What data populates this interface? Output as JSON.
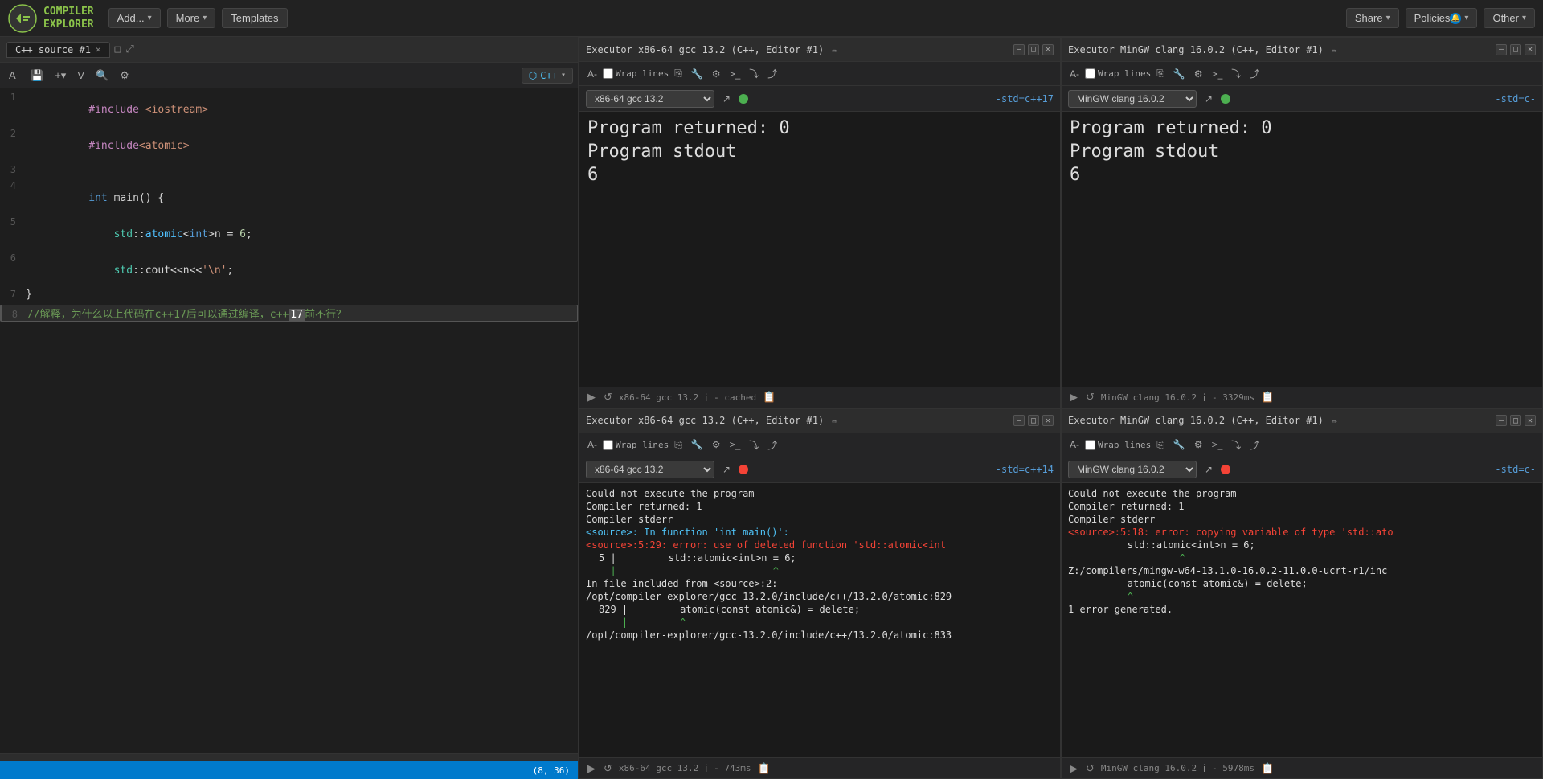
{
  "nav": {
    "logo_line1": "COMPILER",
    "logo_line2": "EXPLORER",
    "add_label": "Add...",
    "more_label": "More",
    "templates_label": "Templates",
    "share_label": "Share",
    "policies_label": "Policies",
    "other_label": "Other"
  },
  "editor": {
    "tab_title": "C++ source #1",
    "lang_label": "C++",
    "lines": [
      {
        "num": "1",
        "content": "#include <iostream>",
        "type": "include"
      },
      {
        "num": "2",
        "content": "#include<atomic>",
        "type": "include"
      },
      {
        "num": "3",
        "content": "",
        "type": "blank"
      },
      {
        "num": "4",
        "content": "int main() {",
        "type": "code"
      },
      {
        "num": "5",
        "content": "    std::atomic<int>n = 6;",
        "type": "code"
      },
      {
        "num": "6",
        "content": "    std::cout<<n<<'\\n';",
        "type": "code"
      },
      {
        "num": "7",
        "content": "}",
        "type": "code"
      },
      {
        "num": "8",
        "content": "//解释，为什么以上代码在c++17后可以通过编译，c++17前不行？",
        "type": "comment"
      }
    ],
    "status_pos": "(8, 36)"
  },
  "panels": [
    {
      "id": "panel-top-left",
      "title": "Executor x86-64 gcc 13.2 (C++, Editor #1)",
      "compiler": "x86-64 gcc 13.2",
      "std_flag": "-std=c++17",
      "status": "success",
      "output_lines": [
        "Program returned: 0",
        "Program stdout",
        "6"
      ],
      "footer_compiler": "x86-64 gcc 13.2",
      "footer_info": "- cached",
      "wrap_lines": "Wrap lines"
    },
    {
      "id": "panel-top-right",
      "title": "Executor MinGW clang 16.0.2 (C++, Editor #1)",
      "compiler": "MinGW clang 16.0.2",
      "std_flag": "-std=c-",
      "status": "success",
      "output_lines": [
        "Program returned: 0",
        "Program stdout",
        "6"
      ],
      "footer_compiler": "MinGW clang 16.0.2",
      "footer_info": "- 3329ms",
      "wrap_lines": "Wrap lines"
    },
    {
      "id": "panel-bottom-left",
      "title": "Executor x86-64 gcc 13.2 (C++, Editor #1)",
      "compiler": "x86-64 gcc 13.2",
      "std_flag": "-std=c++14",
      "status": "error",
      "output_lines": [
        "Could not execute the program",
        "Compiler returned: 1",
        "Compiler stderr",
        "<source>: In function 'int main()':",
        "<source>:5:29: error: use of deleted function 'std::atomic<int",
        "  5 |         std::atomic<int>n = 6;",
        "    |                           ^",
        "In file included from <source>:2:",
        "/opt/compiler-explorer/gcc-13.2.0/include/c++/13.2.0/atomic:829",
        "  829 |         atomic(const atomic&) = delete;",
        "      |         ^",
        "/opt/compiler-explorer/gcc-13.2.0/include/c++/13.2.0/atomic:833"
      ],
      "footer_compiler": "x86-64 gcc 13.2",
      "footer_info": "- 743ms",
      "wrap_lines": "Wrap lines"
    },
    {
      "id": "panel-bottom-right",
      "title": "Executor MinGW clang 16.0.2 (C++, Editor #1)",
      "compiler": "MinGW clang 16.0.2",
      "std_flag": "-std=c-",
      "status": "error",
      "output_lines": [
        "Could not execute the program",
        "Compiler returned: 1",
        "Compiler stderr",
        "<source>:5:18: error: copying variable of type 'std::ato",
        "        std::atomic<int>n = 6;",
        "                 ^",
        "Z:/compilers/mingw-w64-13.1.0-16.0.2-11.0.0-ucrt-r1/inc",
        "        atomic(const atomic&) = delete;",
        "        ^",
        "1 error generated."
      ],
      "footer_compiler": "MinGW clang 16.0.2",
      "footer_info": "- 5978ms",
      "wrap_lines": "Wrap lines"
    }
  ],
  "icons": {
    "logo": "⚙",
    "add_caret": "▾",
    "more_caret": "▾",
    "font_size": "A",
    "save": "💾",
    "add_pane": "+▾",
    "vim": "V",
    "search": "🔍",
    "settings": "⚙",
    "close": "✕",
    "maximize": "□",
    "minimize": "—",
    "run": "▶",
    "refresh": "↺",
    "info": "i",
    "copy": "⎘",
    "wrench": "🔧",
    "terminal": ">_",
    "link_out": "↗",
    "pin": "📌",
    "log": "📋",
    "share_out": "⤴"
  }
}
